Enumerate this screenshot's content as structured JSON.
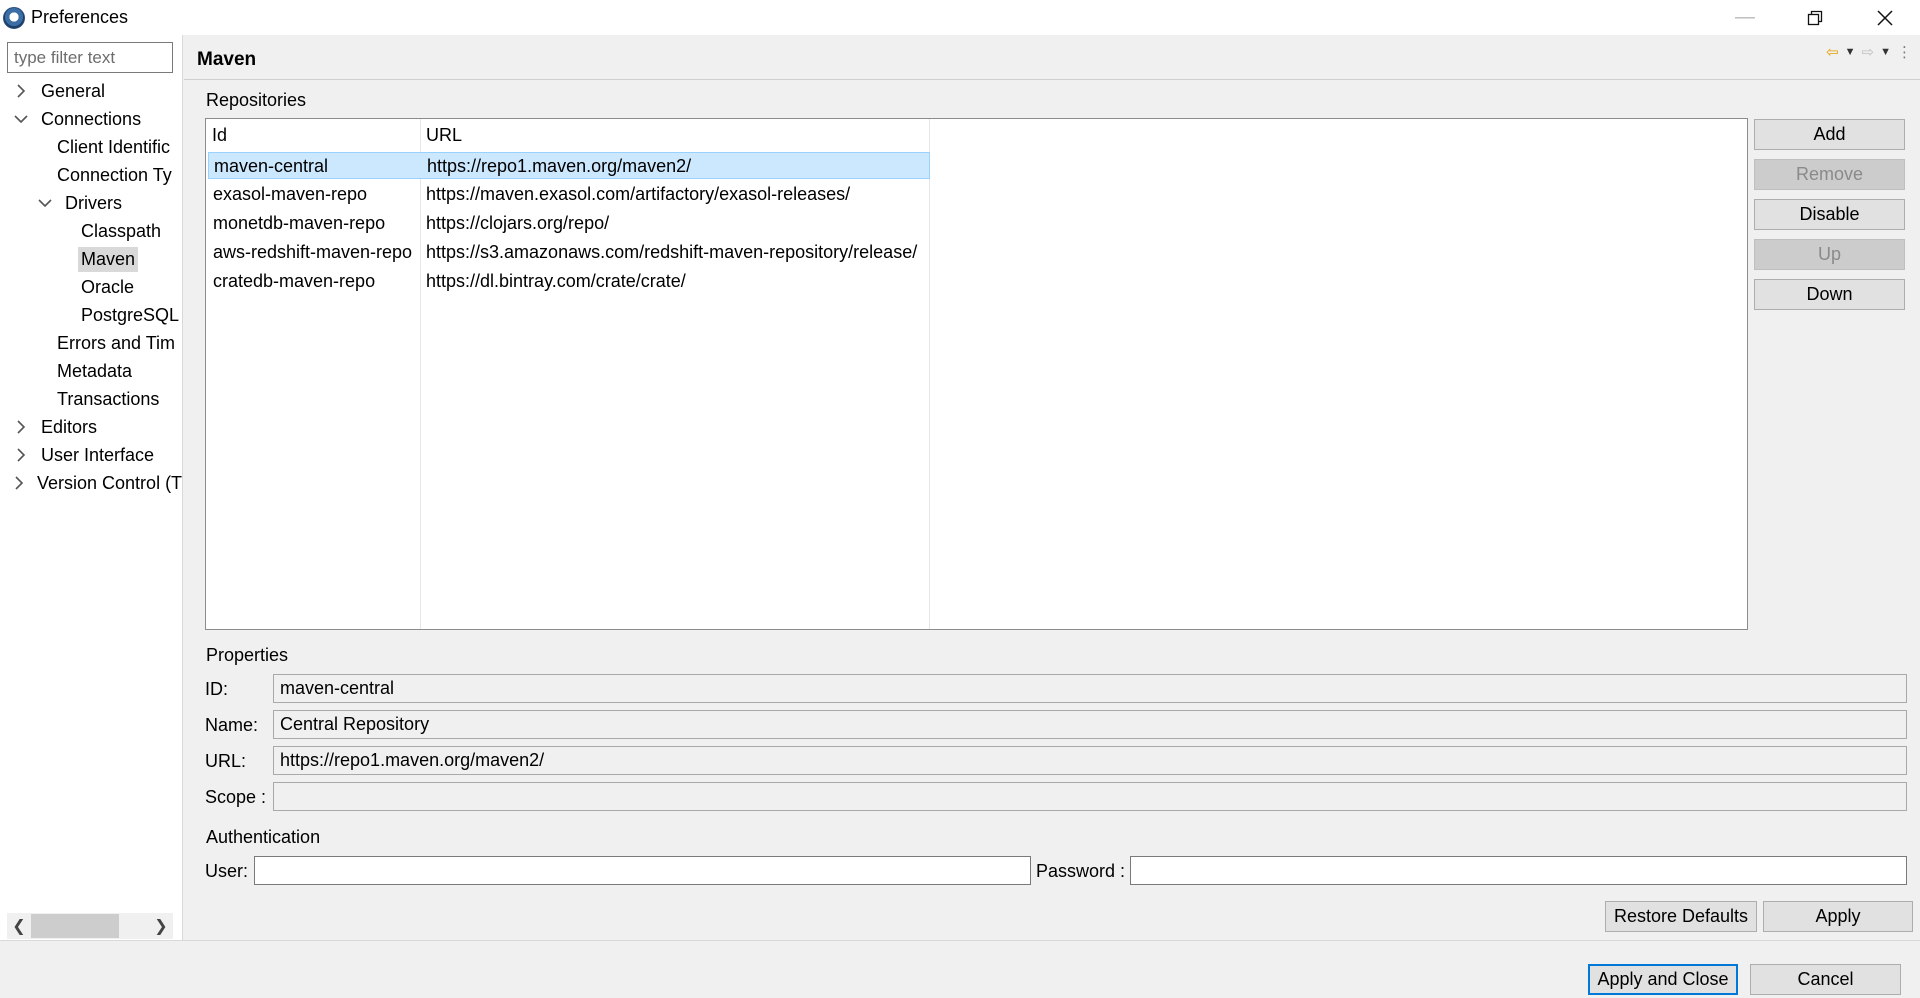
{
  "window": {
    "title": "Preferences",
    "minimize_icon": "minimize-icon",
    "maximize_icon": "restore-icon",
    "close_icon": "close-icon"
  },
  "filter": {
    "placeholder": "type filter text",
    "value": ""
  },
  "tree": [
    {
      "label": "General",
      "level": 0,
      "twisty": "collapsed"
    },
    {
      "label": "Connections",
      "level": 0,
      "twisty": "expanded"
    },
    {
      "label": "Client Identific",
      "level": 1,
      "twisty": "none"
    },
    {
      "label": "Connection Ty",
      "level": 1,
      "twisty": "none"
    },
    {
      "label": "Drivers",
      "level": 1,
      "twisty": "expanded"
    },
    {
      "label": "Classpath",
      "level": 2,
      "twisty": "none"
    },
    {
      "label": "Maven",
      "level": 2,
      "twisty": "none",
      "selected": true
    },
    {
      "label": "Oracle",
      "level": 2,
      "twisty": "none"
    },
    {
      "label": "PostgreSQL",
      "level": 2,
      "twisty": "none"
    },
    {
      "label": "Errors and Tim",
      "level": 1,
      "twisty": "none"
    },
    {
      "label": "Metadata",
      "level": 1,
      "twisty": "none"
    },
    {
      "label": "Transactions",
      "level": 1,
      "twisty": "none"
    },
    {
      "label": "Editors",
      "level": 0,
      "twisty": "collapsed"
    },
    {
      "label": "User Interface",
      "level": 0,
      "twisty": "collapsed"
    },
    {
      "label": "Version Control (T",
      "level": 0,
      "twisty": "collapsed"
    }
  ],
  "page": {
    "title": "Maven"
  },
  "repositories": {
    "group_label": "Repositories",
    "columns": [
      "Id",
      "URL"
    ],
    "rows": [
      {
        "id": "maven-central",
        "url": "https://repo1.maven.org/maven2/",
        "selected": true
      },
      {
        "id": "exasol-maven-repo",
        "url": "https://maven.exasol.com/artifactory/exasol-releases/"
      },
      {
        "id": "monetdb-maven-repo",
        "url": "https://clojars.org/repo/"
      },
      {
        "id": "aws-redshift-maven-repo",
        "url": "https://s3.amazonaws.com/redshift-maven-repository/release/"
      },
      {
        "id": "cratedb-maven-repo",
        "url": "https://dl.bintray.com/crate/crate/"
      }
    ],
    "buttons": {
      "add": "Add",
      "remove": "Remove",
      "disable": "Disable",
      "up": "Up",
      "down": "Down"
    }
  },
  "properties": {
    "group_label": "Properties",
    "id_label": "ID:",
    "id_value": "maven-central",
    "name_label": "Name:",
    "name_value": "Central Repository",
    "url_label": "URL:",
    "url_value": "https://repo1.maven.org/maven2/",
    "scope_label": "Scope :",
    "scope_value": ""
  },
  "authentication": {
    "group_label": "Authentication",
    "user_label": "User:",
    "user_value": "",
    "password_label": "Password :",
    "password_value": ""
  },
  "actions": {
    "restore_defaults": "Restore Defaults",
    "apply": "Apply",
    "apply_and_close": "Apply and Close",
    "cancel": "Cancel"
  },
  "colors": {
    "selection": "#cce8ff",
    "default_button_border": "#0078d7"
  }
}
